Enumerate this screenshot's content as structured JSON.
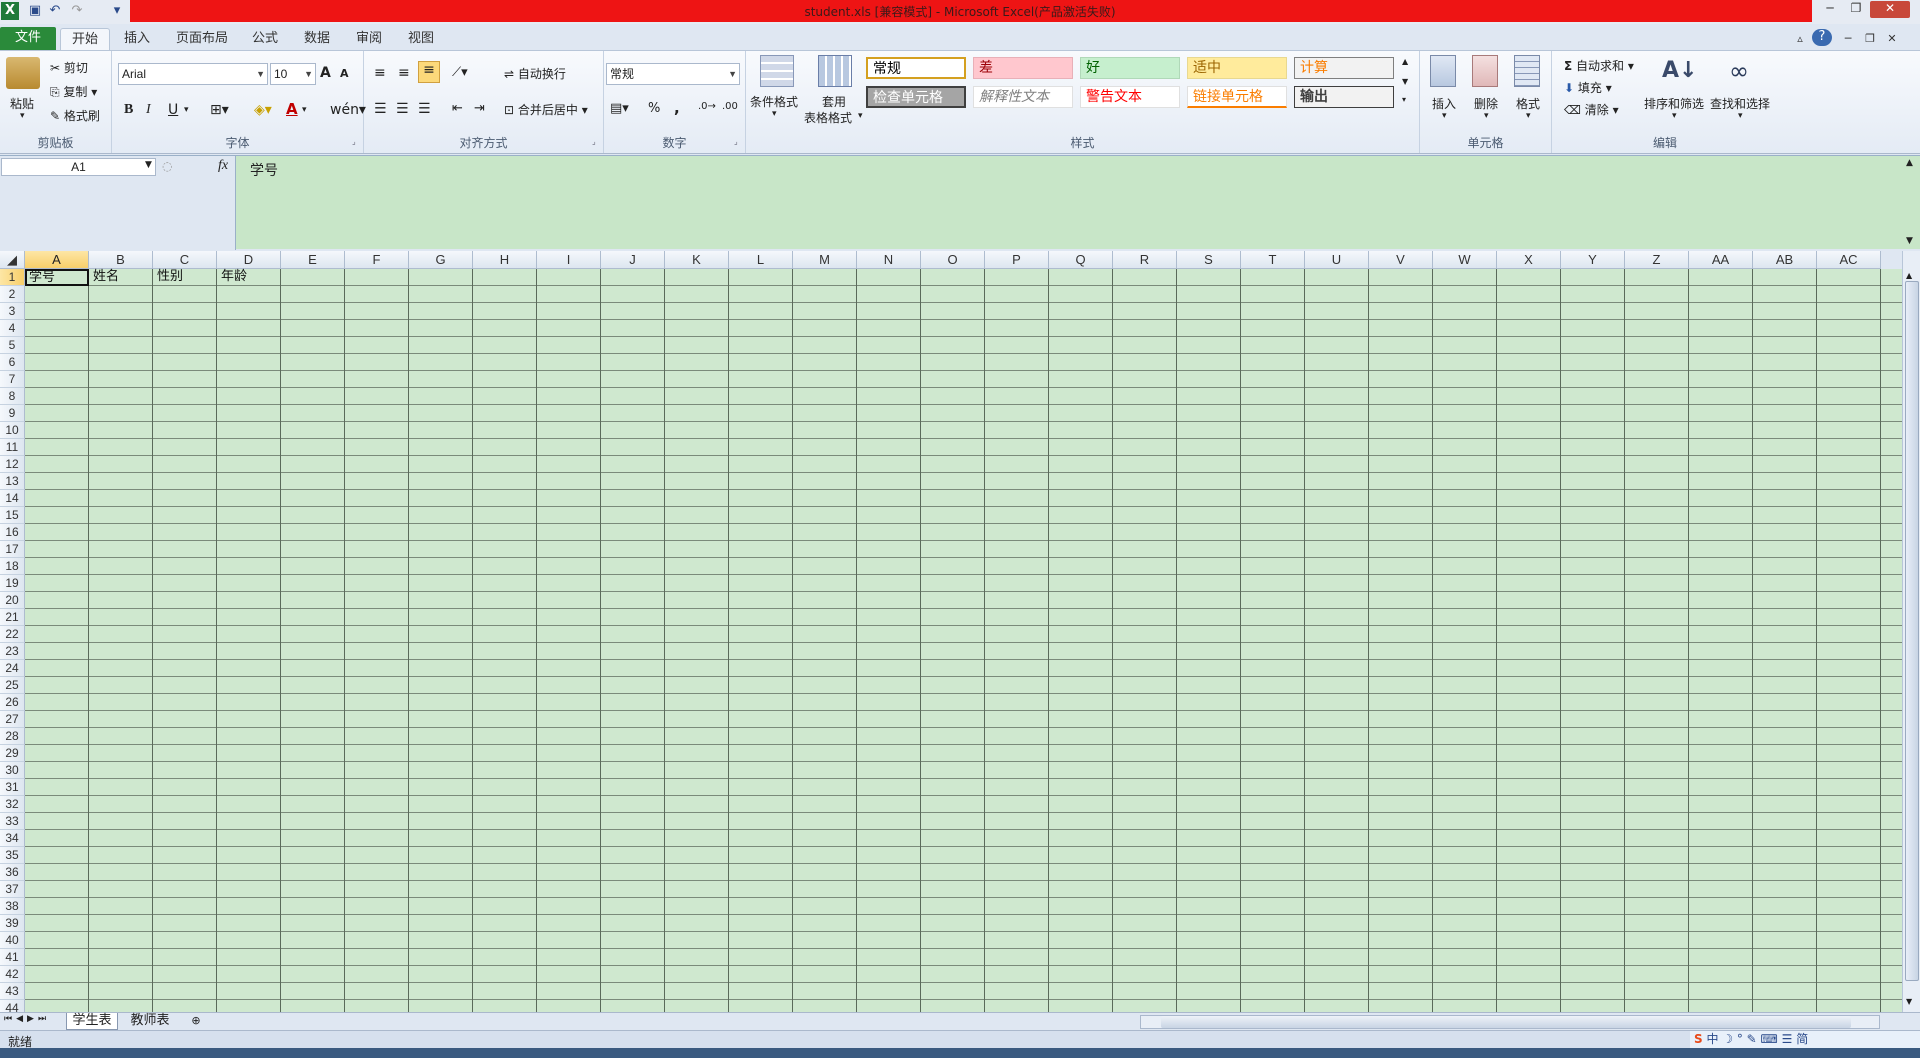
{
  "window": {
    "title": "student.xls  [兼容模式]  -  Microsoft Excel(产品激活失败)",
    "min": "─",
    "max": "❐",
    "close": "✕"
  },
  "qat": {
    "excel_icon": "excel-icon",
    "save": "💾",
    "undo": "↶",
    "redo": "↷",
    "more": "▾"
  },
  "tabs": [
    "开始",
    "插入",
    "页面布局",
    "公式",
    "数据",
    "审阅",
    "视图"
  ],
  "file_tab": "文件",
  "ribbon": {
    "clipboard": {
      "paste": "粘贴",
      "cut": "剪切",
      "copy": "复制",
      "painter": "格式刷",
      "label": "剪贴板"
    },
    "font": {
      "name": "Arial",
      "size": "10",
      "bold": "B",
      "italic": "I",
      "underline": "U",
      "grow": "A",
      "shrink": "A",
      "font_color": "A",
      "label": "字体"
    },
    "alignment": {
      "wrap": "自动换行",
      "merge": "合并后居中",
      "label": "对齐方式"
    },
    "number": {
      "format": "常规",
      "percent": "%",
      "comma": ",",
      "label": "数字"
    },
    "styles": {
      "cond": "条件格式",
      "table_a": "套用",
      "table_b": "表格格式",
      "cells": [
        {
          "text": "常规",
          "bg": "#ffffff",
          "color": "#000000",
          "border": "#d4a020"
        },
        {
          "text": "差",
          "bg": "#ffc7ce",
          "color": "#9c0006",
          "border": "#e8b0b8"
        },
        {
          "text": "好",
          "bg": "#c6efce",
          "color": "#006100",
          "border": "#b0d8b8"
        },
        {
          "text": "适中",
          "bg": "#ffeb9c",
          "color": "#9c6500",
          "border": "#e8d890"
        },
        {
          "text": "计算",
          "bg": "#f2f2f2",
          "color": "#fa7d00",
          "border": "#7f7f7f"
        },
        {
          "text": "检查单元格",
          "bg": "#a5a5a5",
          "color": "#ffffff",
          "border": "#3f3f3f"
        },
        {
          "text": "解释性文本",
          "bg": "#ffffff",
          "color": "#7f7f7f",
          "border": "#e0e0e0"
        },
        {
          "text": "警告文本",
          "bg": "#ffffff",
          "color": "#ff0000",
          "border": "#e0e0e0"
        },
        {
          "text": "链接单元格",
          "bg": "#ffffff",
          "color": "#fa7d00",
          "border": "#e0e0e0"
        },
        {
          "text": "输出",
          "bg": "#f2f2f2",
          "color": "#3f3f3f",
          "border": "#3f3f3f"
        }
      ],
      "label": "样式"
    },
    "cells_grp": {
      "insert": "插入",
      "delete": "删除",
      "format": "格式",
      "label": "单元格"
    },
    "editing": {
      "autosum": "自动求和",
      "fill": "填充",
      "clear": "清除",
      "sort": "排序和筛选",
      "find": "查找和选择",
      "label": "编辑"
    }
  },
  "formula": {
    "namebox": "A1",
    "fx": "fx",
    "value": "学号"
  },
  "columns": [
    "A",
    "B",
    "C",
    "D",
    "E",
    "F",
    "G",
    "H",
    "I",
    "J",
    "K",
    "L",
    "M",
    "N",
    "O",
    "P",
    "Q",
    "R",
    "S",
    "T",
    "U",
    "V",
    "W",
    "X",
    "Y",
    "Z",
    "AA",
    "AB",
    "AC"
  ],
  "rows": [
    "1",
    "2",
    "3",
    "4",
    "5",
    "6",
    "7",
    "8",
    "9",
    "10",
    "11",
    "12",
    "13",
    "14",
    "15",
    "16",
    "17",
    "18",
    "19",
    "20",
    "21",
    "22",
    "23",
    "24",
    "25",
    "26",
    "27",
    "28",
    "29",
    "30",
    "31",
    "32",
    "33",
    "34",
    "35",
    "36",
    "37",
    "38",
    "39",
    "40",
    "41",
    "42",
    "43",
    "44"
  ],
  "cells": {
    "A1": "学号",
    "B1": "姓名",
    "C1": "性别",
    "D1": "年龄"
  },
  "sheets": [
    "学生表",
    "教师表"
  ],
  "status": {
    "ready": "就绪"
  },
  "colors": {
    "title_red": "#ee1414",
    "file_green": "#2a8a3a",
    "grid_green": "#cfe8cf"
  }
}
